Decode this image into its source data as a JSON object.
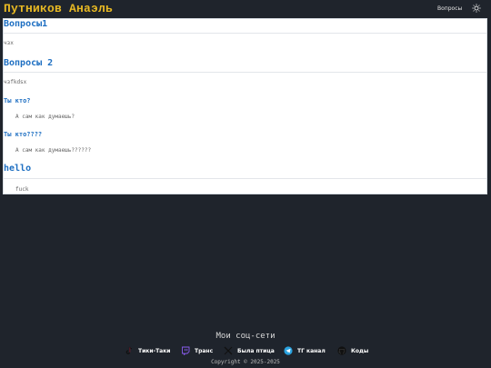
{
  "header": {
    "site_title": "Путников Анаэль",
    "nav_questions": "Вопросы"
  },
  "questions": [
    {
      "title": "Вопросы1",
      "answer": "чзх"
    },
    {
      "title": "Вопросы 2",
      "answer": "чзfkdsx"
    },
    {
      "title": "Ты кто?",
      "answer": "А сам как думаешь?"
    },
    {
      "title": "Ты кто????",
      "answer": "А сам как думаешь??????"
    },
    {
      "title": "hello",
      "answer": "fuck"
    }
  ],
  "footer": {
    "title": "Мои соц-сети",
    "socials": [
      {
        "label": "Тики-Таки",
        "icon": "tiktok-icon"
      },
      {
        "label": "Транс",
        "icon": "twitch-icon"
      },
      {
        "label": "Была птица",
        "icon": "x-icon"
      },
      {
        "label": "ТГ канал",
        "icon": "telegram-icon"
      },
      {
        "label": "Коды",
        "icon": "github-icon"
      }
    ],
    "copyright": "Copyright © 2025-2025"
  },
  "colors": {
    "background": "#1f242c",
    "title_accent": "#e8b923",
    "question_blue": "#1e6fc2"
  }
}
